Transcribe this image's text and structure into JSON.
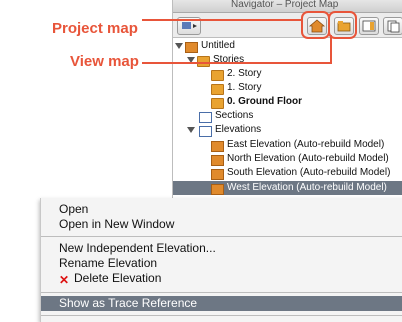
{
  "window": {
    "title": "Navigator – Project Map"
  },
  "callouts": {
    "project_map": "Project map",
    "view_map": "View map"
  },
  "tree": {
    "root": "Untitled",
    "stories_label": "Stories",
    "stories": [
      "2. Story",
      "1. Story",
      "0. Ground Floor"
    ],
    "sections": "Sections",
    "elevations_label": "Elevations",
    "elevations": [
      "East Elevation (Auto-rebuild Model)",
      "North Elevation (Auto-rebuild Model)",
      "South Elevation (Auto-rebuild Model)",
      "West Elevation (Auto-rebuild Model)"
    ]
  },
  "context_menu": {
    "open": "Open",
    "open_new_window": "Open in New Window",
    "new_independent_elevation": "New Independent Elevation...",
    "rename_elevation": "Rename Elevation",
    "delete_elevation": "Delete Elevation",
    "show_as_trace_reference": "Show as Trace Reference"
  },
  "colors": {
    "callout": "#e8553a",
    "highlight": "#6d7784",
    "folder": "#e9a331"
  }
}
